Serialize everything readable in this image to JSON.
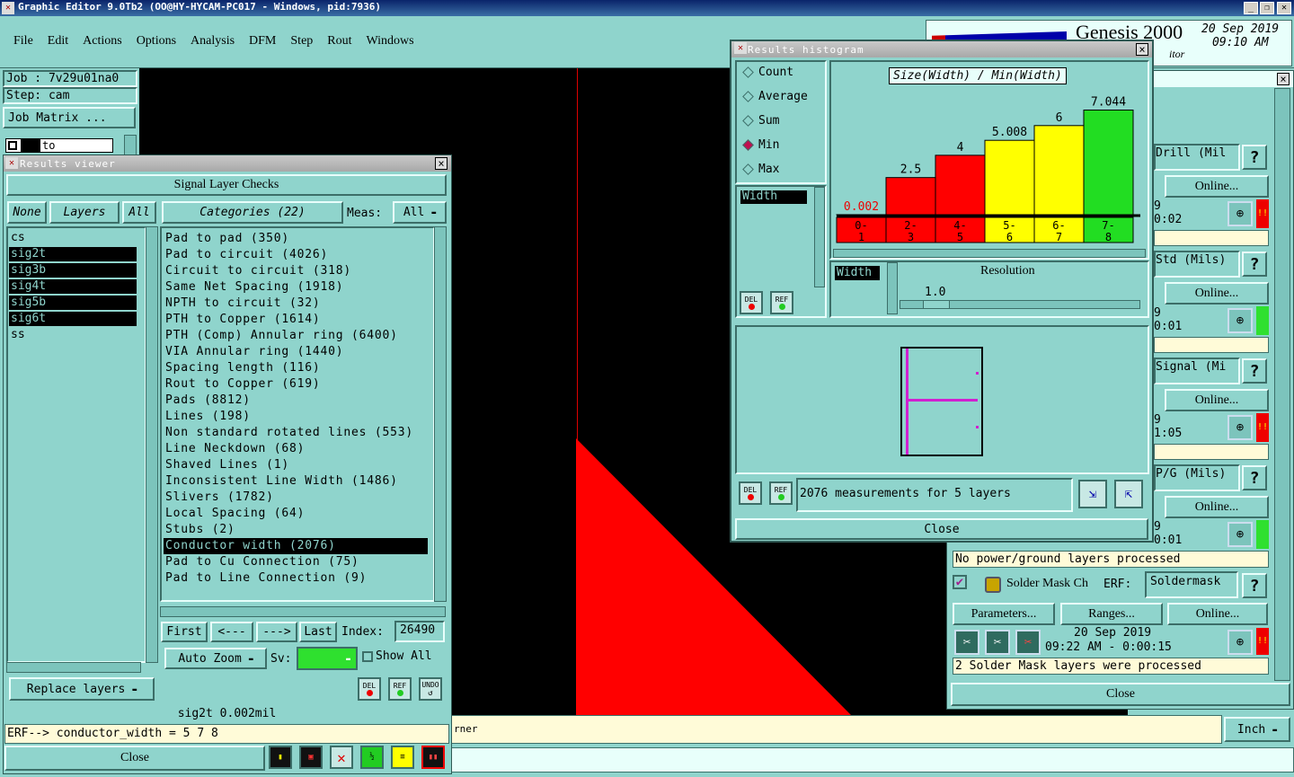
{
  "window": {
    "title": "Graphic Editor 9.0Tb2 (OO@HY-HYCAM-PC017 - Windows, pid:7936)"
  },
  "menu": [
    "File",
    "Edit",
    "Actions",
    "Options",
    "Analysis",
    "DFM",
    "Step",
    "Rout",
    "Windows"
  ],
  "brand": {
    "name": "Genesis 2000",
    "sub": "itor",
    "date": "20 Sep 2019",
    "time": "09:10 AM"
  },
  "job": {
    "job_label": "Job : 7v29u01na0",
    "step_label": "Step: cam",
    "matrix_button": "Job Matrix ...",
    "to_label": "to"
  },
  "results_viewer": {
    "title": "Results viewer",
    "heading": "Signal Layer Checks",
    "btn_none": "None",
    "btn_layers": "Layers",
    "btn_all": "All",
    "categories_label": "Categories (22)",
    "meas_label": "Meas:",
    "meas_value": "All",
    "layers": [
      "cs",
      "sig2t",
      "sig3b",
      "sig4t",
      "sig5b",
      "sig6t",
      "ss"
    ],
    "categories": [
      "Pad to pad (350)",
      "Pad to circuit (4026)",
      "Circuit to circuit (318)",
      "Same Net Spacing (1918)",
      "NPTH to circuit (32)",
      "PTH to Copper (1614)",
      "PTH (Comp) Annular ring (6400)",
      "VIA Annular ring (1440)",
      "Spacing length (116)",
      "Rout to Copper (619)",
      "Pads (8812)",
      "Lines (198)",
      "Non standard rotated lines (553)",
      "Line Neckdown (68)",
      "Shaved Lines (1)",
      "Inconsistent Line Width (1486)",
      "Slivers (1782)",
      "Local Spacing (64)",
      "Stubs (2)",
      "Conductor width (2076)",
      "Pad to Cu Connection (75)",
      "Pad to Line Connection (9)"
    ],
    "nav": {
      "first": "First",
      "prev": "<---",
      "next": "--->",
      "last": "Last",
      "index_label": "Index:",
      "index_value": "26490"
    },
    "auto_zoom": "Auto Zoom",
    "sv_label": "Sv:",
    "show_all": "Show All",
    "replace_layers": "Replace layers",
    "del": "DEL",
    "ref": "REF",
    "undo": "UNDO",
    "status": "sig2t 0.002mil",
    "erf_line": "ERF--> conductor_width = 5 7 8",
    "close": "Close"
  },
  "histogram": {
    "title": "Results histogram",
    "modes": [
      "Count",
      "Average",
      "Sum",
      "Min",
      "Max"
    ],
    "selected_mode": "Min",
    "measure_item": "Width",
    "chart_title": "Size(Width) / Min(Width)",
    "resolution_label": "Resolution",
    "resolution_value": "1.0",
    "width_label": "Width",
    "summary": "2076 measurements for 5 layers",
    "close": "Close",
    "del": "DEL",
    "ref": "REF"
  },
  "chart_data": {
    "type": "bar",
    "title": "Size(Width) / Min(Width)",
    "categories": [
      "0-1",
      "2-3",
      "4-5",
      "5-6",
      "6-7",
      "7-8"
    ],
    "values": [
      0.002,
      2.5,
      4,
      5.008,
      6,
      7.044
    ],
    "value_labels": [
      "0.002",
      "2.5",
      "4",
      "5.008",
      "6",
      "7.044"
    ],
    "category_top": [
      "0-",
      "2-",
      "4-",
      "5-",
      "6-",
      "7-"
    ],
    "category_bottom": [
      "1",
      "3",
      "5",
      "6",
      "7",
      "8"
    ],
    "colors": [
      "#ff0000",
      "#ff0000",
      "#ff0000",
      "#ffff00",
      "#ffff00",
      "#22dd22"
    ],
    "ylim": [
      0,
      7.5
    ]
  },
  "checklist": {
    "rows": [
      {
        "name": "Drill (Mil",
        "online": "Online...",
        "time": "0:02",
        "flag": "red"
      },
      {
        "name": "Std (Mils)",
        "online": "Online...",
        "time": "0:01",
        "flag": "green"
      },
      {
        "name": "Signal (Mi",
        "online": "Online...",
        "time": "1:05",
        "flag": "red"
      },
      {
        "name": "P/G (Mils)",
        "online": "Online...",
        "time": "0:01",
        "flag": "green"
      }
    ],
    "row_digit": "9",
    "pg_message": "No power/ground layers processed",
    "solder": {
      "name": "Solder Mask Ch",
      "erf_label": "ERF:",
      "erf_value": "Soldermask",
      "parameters": "Parameters...",
      "ranges": "Ranges...",
      "online": "Online...",
      "date": "20 Sep 2019",
      "time": "09:22 AM - 0:00:15",
      "message": "2 Solder Mask layers were processed"
    },
    "help": "?",
    "close": "Close"
  },
  "bottom": {
    "corner_text": "rner",
    "units": "Inch"
  },
  "colors": {
    "bg": "#8fd4cc",
    "red": "#ff0000",
    "yellow": "#ffff00",
    "green": "#22dd22",
    "dark": "#000000",
    "cream": "#fffbd8"
  }
}
